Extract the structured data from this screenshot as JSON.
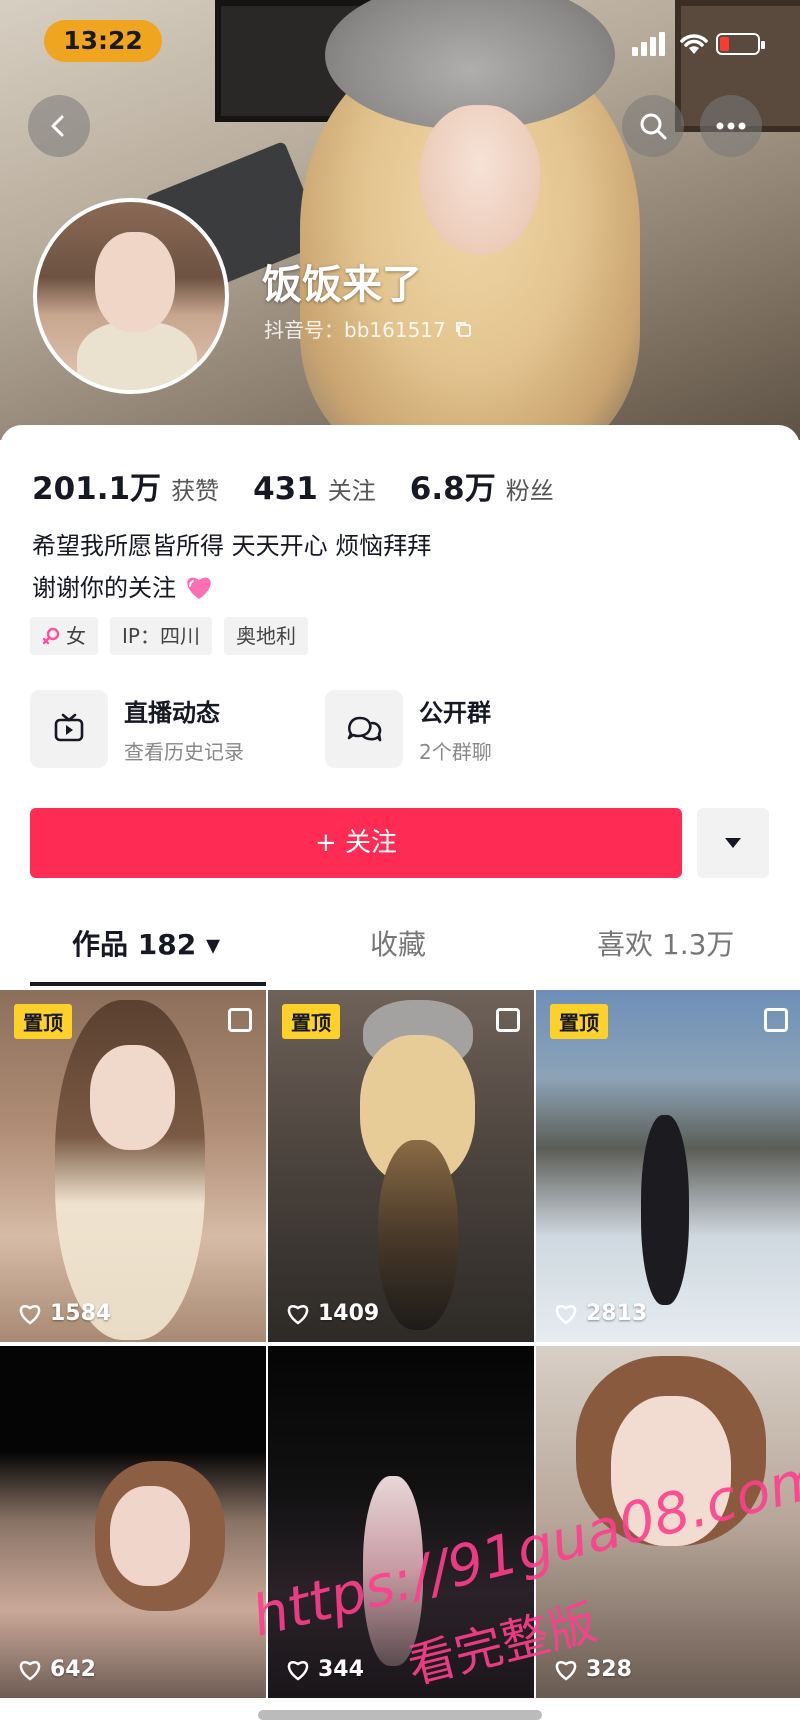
{
  "status": {
    "time": "13:22",
    "battery_color": "#ff3b30"
  },
  "header": {
    "back_icon": "chevron-left-icon",
    "search_icon": "search-icon",
    "more_icon": "more-dots-icon"
  },
  "profile": {
    "nickname": "饭饭来了",
    "douyin_id": "抖音号：bb161517",
    "stats": [
      {
        "value": "201.1万",
        "label": "获赞"
      },
      {
        "value": "431",
        "label": "关注"
      },
      {
        "value": "6.8万",
        "label": "粉丝"
      }
    ],
    "bio_line1": "希望我所愿皆所得 天天开心 烦恼拜拜",
    "bio_line2": "谢谢你的关注",
    "tags": [
      {
        "text": "女",
        "icon": "female-icon"
      },
      {
        "text": "IP：四川"
      },
      {
        "text": "奥地利"
      }
    ]
  },
  "features": [
    {
      "title": "直播动态",
      "subtitle": "查看历史记录",
      "icon": "live-tv-icon"
    },
    {
      "title": "公开群",
      "subtitle": "2个群聊",
      "icon": "chat-bubbles-icon"
    }
  ],
  "follow_button": "+ 关注",
  "accent": "#fe2c55",
  "tabs": [
    {
      "label": "作品 182 ▾",
      "active": true
    },
    {
      "label": "收藏",
      "active": false
    },
    {
      "label": "喜欢 1.3万",
      "active": false
    }
  ],
  "pin_label": "置顶",
  "videos": [
    {
      "likes": "1584",
      "pinned": true
    },
    {
      "likes": "1409",
      "pinned": true
    },
    {
      "likes": "2813",
      "pinned": true
    },
    {
      "likes": "642",
      "pinned": false
    },
    {
      "likes": "344",
      "pinned": false
    },
    {
      "likes": "328",
      "pinned": false
    }
  ],
  "watermark": {
    "line1": "https://91gua08.com",
    "line2": "看完整版"
  }
}
